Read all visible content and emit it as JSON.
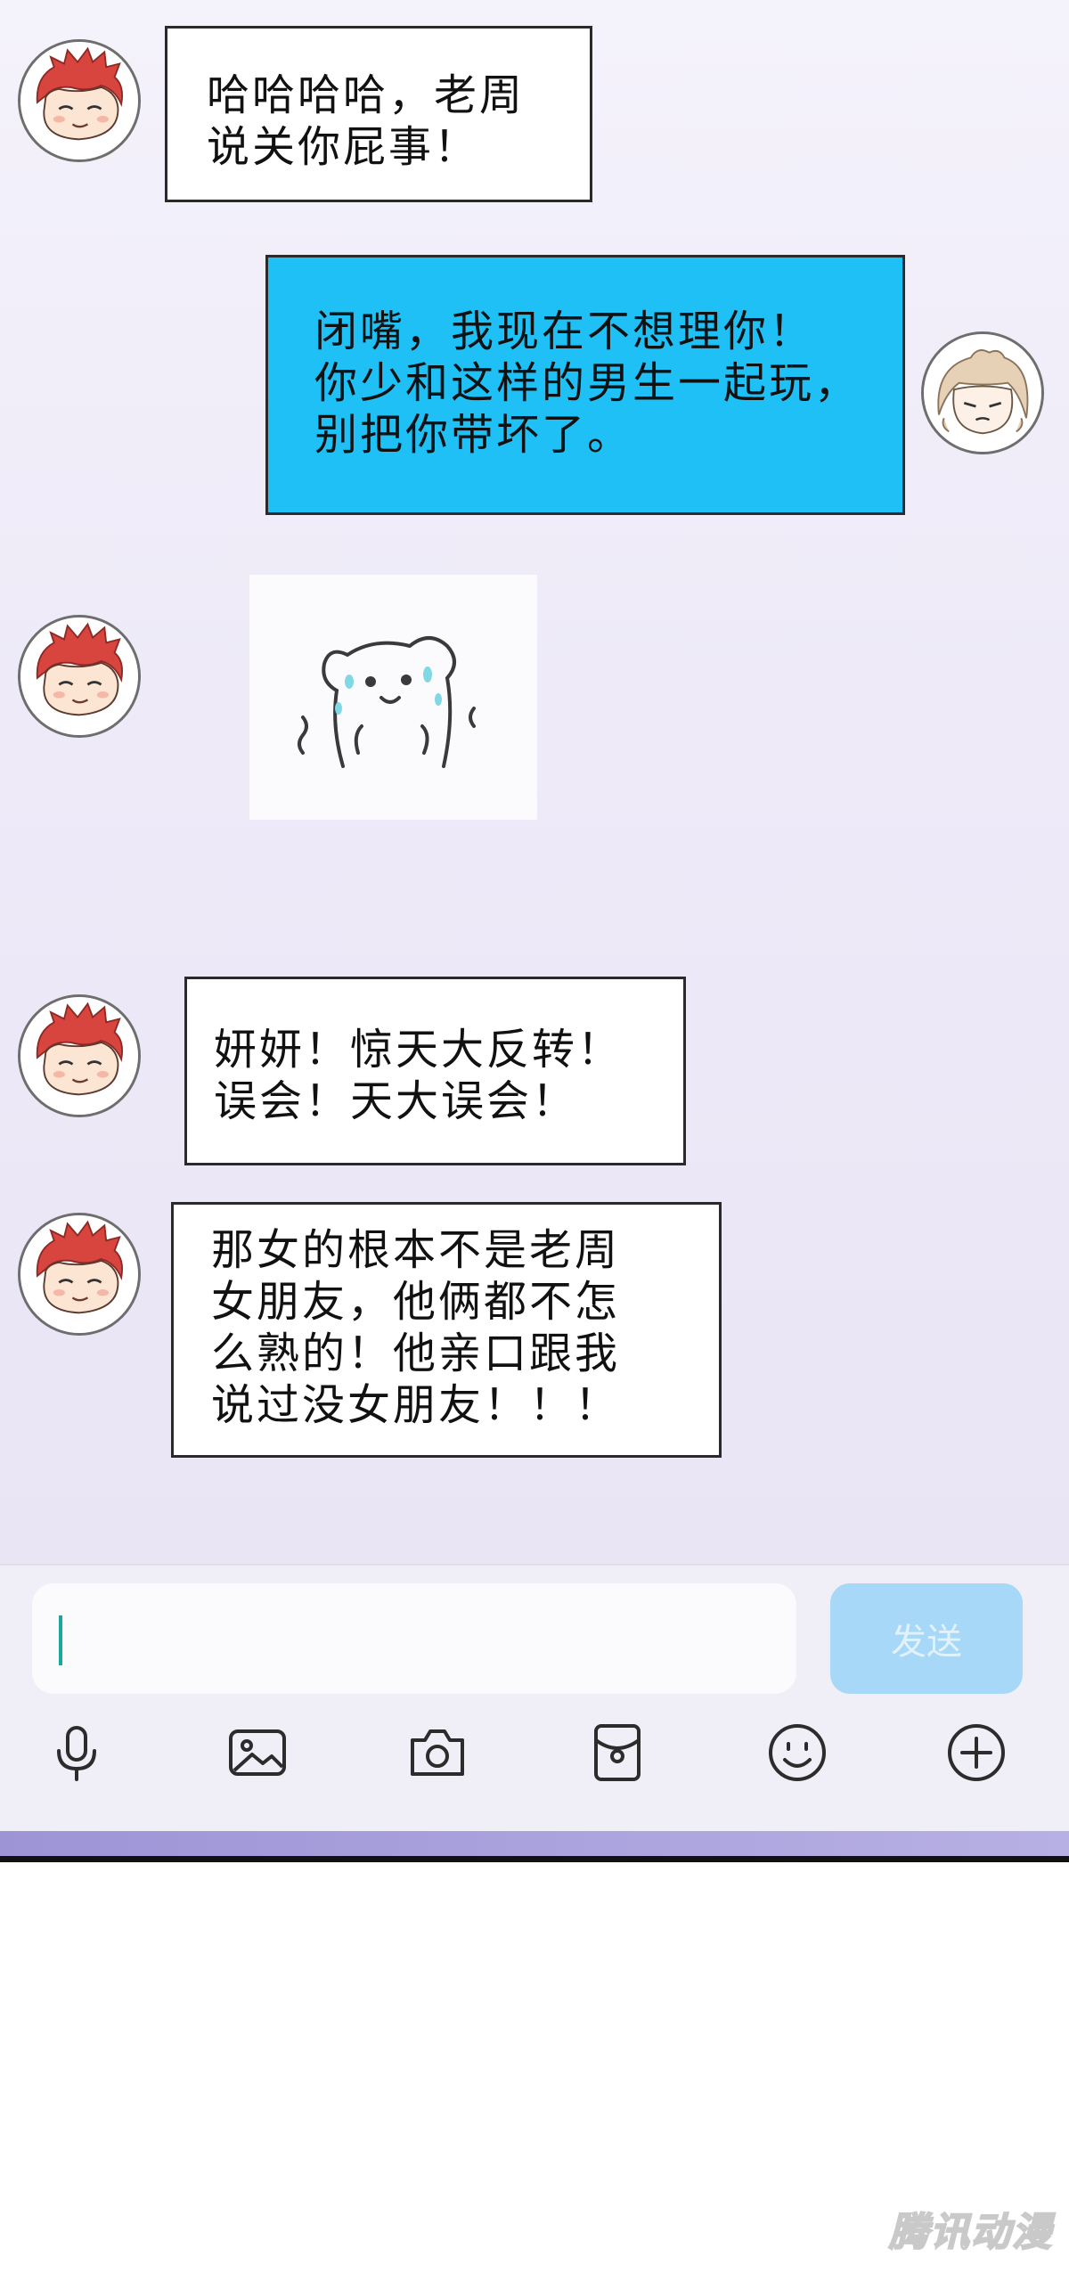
{
  "messages": [
    {
      "sender": "friend",
      "text": "哈哈哈哈，老周\n说关你屁事！"
    },
    {
      "sender": "self",
      "text": "闭嘴，我现在不想理你！\n你少和这样的男生一起玩，\n别把你带坏了。"
    },
    {
      "sender": "friend",
      "sticker": "sweating-bear-sticker"
    },
    {
      "sender": "friend",
      "text": "妍妍！惊天大反转！\n误会！天大误会！"
    },
    {
      "sender": "friend",
      "text": "那女的根本不是老周\n女朋友，他俩都不怎\n么熟的！他亲口跟我\n说过没女朋友！！！"
    }
  ],
  "composer": {
    "input_value": "",
    "send_label": "发送",
    "tools": [
      "microphone-icon",
      "image-icon",
      "camera-icon",
      "red-packet-icon",
      "emoji-icon",
      "plus-icon"
    ]
  },
  "watermark": "腾讯动漫",
  "colors": {
    "self_bubble": "#1ec0f5",
    "send_button": "#a8d8f8",
    "chat_bg": "#eeeaf8"
  }
}
